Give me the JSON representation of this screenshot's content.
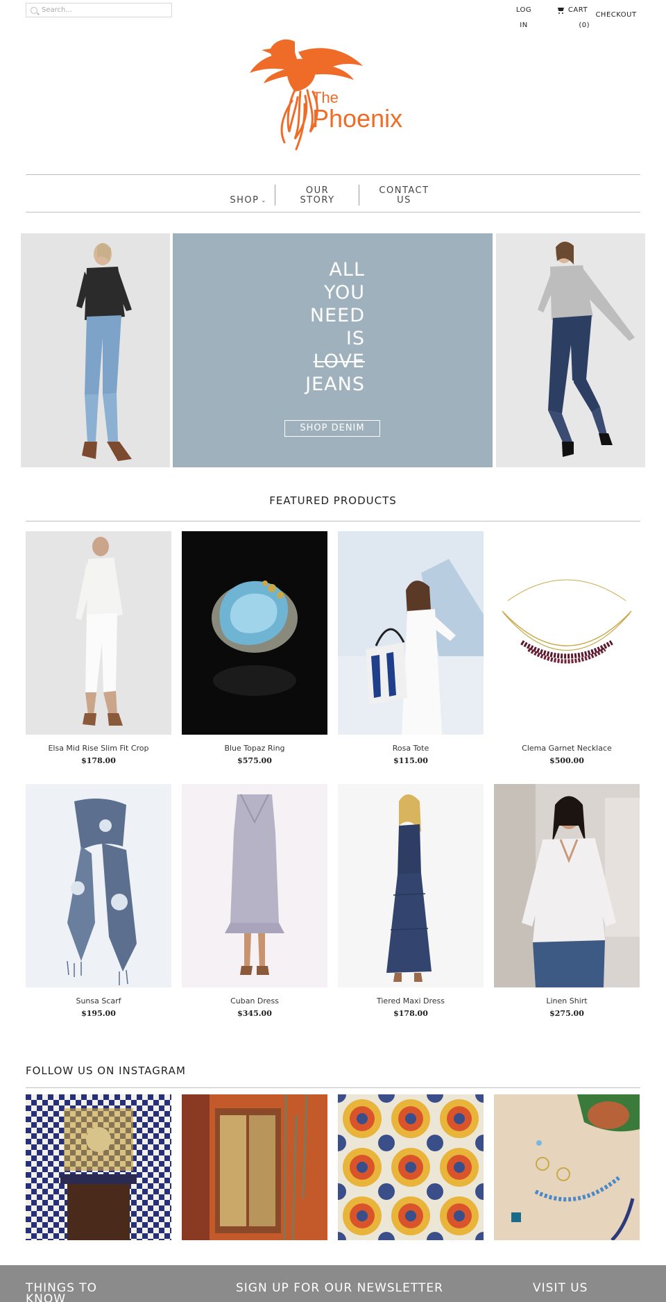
{
  "header": {
    "search_placeholder": "Search...",
    "login_line1": "LOG",
    "login_line2": "IN",
    "cart_label": "CART",
    "cart_count": "(0)",
    "checkout_label": "CHECKOUT"
  },
  "logo": {
    "brand_the": "The",
    "brand_name": "Phoenix",
    "color": "#ef6c28"
  },
  "nav": {
    "shop": "SHOP",
    "story_line1": "OUR",
    "story_line2": "STORY",
    "contact_line1": "CONTACT",
    "contact_line2": "US"
  },
  "hero": {
    "lines": [
      "ALL",
      "YOU",
      "NEED",
      "IS",
      "LOVE",
      "JEANS"
    ],
    "button": "SHOP DENIM",
    "panel_color": "#9fb1bd"
  },
  "featured": {
    "title": "FEATURED PRODUCTS",
    "products": [
      {
        "name": "Elsa Mid Rise Slim Fit Crop",
        "price": "$178.00"
      },
      {
        "name": "Blue Topaz Ring",
        "price": "$575.00"
      },
      {
        "name": "Rosa Tote",
        "price": "$115.00"
      },
      {
        "name": "Clema Garnet Necklace",
        "price": "$500.00"
      },
      {
        "name": "Sunsa Scarf",
        "price": "$195.00"
      },
      {
        "name": "Cuban Dress",
        "price": "$345.00"
      },
      {
        "name": "Tiered Maxi Dress",
        "price": "$178.00"
      },
      {
        "name": "Linen Shirt",
        "price": "$275.00"
      }
    ]
  },
  "instagram": {
    "title": "FOLLOW US ON INSTAGRAM"
  },
  "footer": {
    "things_line1": "THINGS TO",
    "things_line2": "KNOW",
    "newsletter": "SIGN UP FOR OUR NEWSLETTER",
    "visit": "VISIT US"
  }
}
